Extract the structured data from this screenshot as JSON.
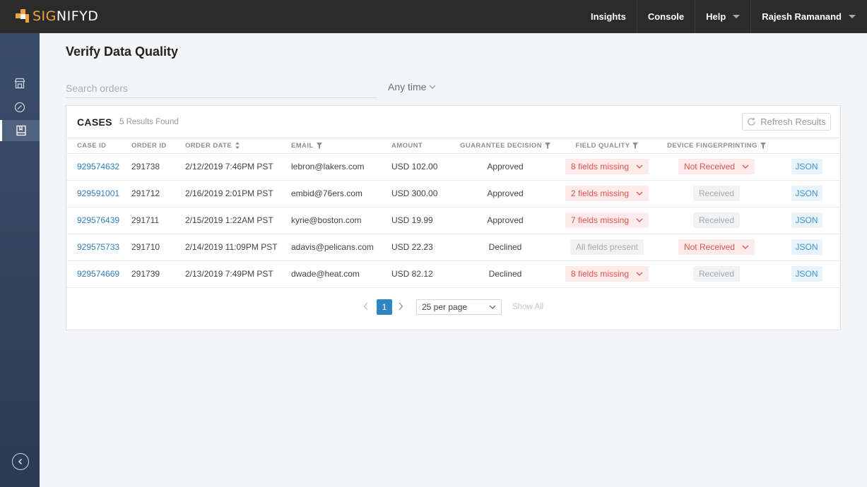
{
  "header": {
    "logo_text": "SIGNIFYD",
    "nav": [
      {
        "label": "Insights"
      },
      {
        "label": "Console"
      },
      {
        "label": "Help"
      },
      {
        "label": "Rajesh Ramanand"
      }
    ]
  },
  "sidebar": {
    "items": [
      {
        "icon": "store-icon"
      },
      {
        "icon": "gauge-icon"
      },
      {
        "icon": "book-icon",
        "active": true
      }
    ],
    "collapse_icon": "chevron-left-icon"
  },
  "page": {
    "title": "Verify Data Quality",
    "search_placeholder": "Search orders",
    "time_filter": "Any time"
  },
  "cases": {
    "title": "CASES",
    "results": "5 Results Found",
    "refresh_label": "Refresh Results",
    "columns": {
      "case_id": "CASE ID",
      "order_id": "ORDER ID",
      "order_date": "ORDER DATE",
      "email": "EMAIL",
      "amount": "AMOUNT",
      "guarantee": "GUARANTEE DECISION",
      "field_quality": "FIELD QUALITY",
      "device": "DEVICE FINGERPRINTING"
    },
    "rows": [
      {
        "case_id": "929574632",
        "order_id": "291738",
        "order_date": "2/12/2019 7:46PM PST",
        "email": "lebron@lakers.com",
        "amount": "USD 102.00",
        "guarantee": "Approved",
        "field_quality": "8 fields missing",
        "field_bad": true,
        "device": "Not Received",
        "device_bad": true,
        "json": "JSON"
      },
      {
        "case_id": "929591001",
        "order_id": "291712",
        "order_date": "2/16/2019 2:01PM PST",
        "email": "embid@76ers.com",
        "amount": "USD 300.00",
        "guarantee": "Approved",
        "field_quality": "2 fields missing",
        "field_bad": true,
        "device": "Received",
        "device_bad": false,
        "json": "JSON"
      },
      {
        "case_id": "929576439",
        "order_id": "291711",
        "order_date": "2/15/2019 1:22AM PST",
        "email": "kyrie@boston.com",
        "amount": "USD 19.99",
        "guarantee": "Approved",
        "field_quality": "7 fields missing",
        "field_bad": true,
        "device": "Received",
        "device_bad": false,
        "json": "JSON"
      },
      {
        "case_id": "929575733",
        "order_id": "291710",
        "order_date": "2/14/2019 11:09PM PST",
        "email": "adavis@pelicans.com",
        "amount": "USD 22.23",
        "guarantee": "Declined",
        "field_quality": "All fields present",
        "field_bad": false,
        "device": "Not Received",
        "device_bad": true,
        "json": "JSON"
      },
      {
        "case_id": "929574669",
        "order_id": "291739",
        "order_date": "2/13/2019 7:49PM PST",
        "email": "dwade@heat.com",
        "amount": "USD 82.12",
        "guarantee": "Declined",
        "field_quality": "8 fields missing",
        "field_bad": true,
        "device": "Received",
        "device_bad": false,
        "json": "JSON"
      }
    ]
  },
  "pagination": {
    "current_page": "1",
    "per_page": "25 per page",
    "show_all": "Show All"
  },
  "colors": {
    "topbar": "#2b2b2b",
    "accent": "#2f84c4",
    "logo_accent": "#f2a23a",
    "error": "#e0524f"
  }
}
